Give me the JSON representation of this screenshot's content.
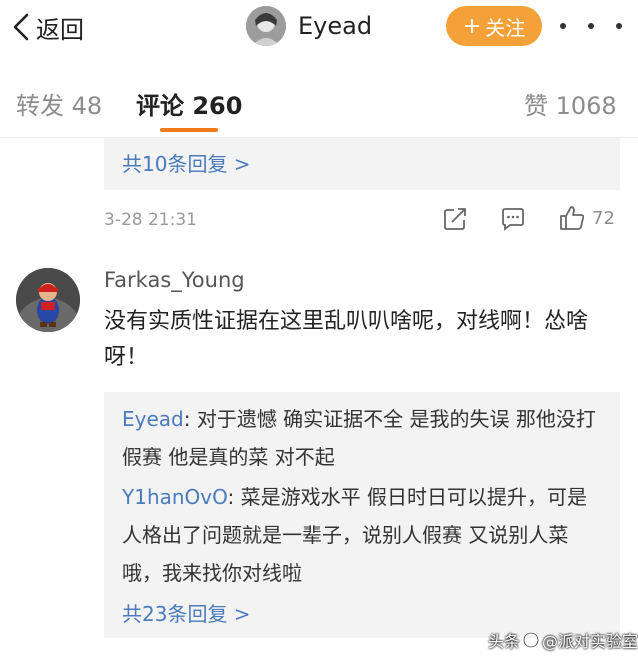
{
  "topbar": {
    "back_label": "返回",
    "profile_name": "Eyead",
    "follow_label": "关注",
    "follow_plus": "+",
    "more_icon": "more-dots-icon",
    "accent_color": "#f5a13a"
  },
  "tabs": {
    "repost": "转发 48",
    "comments": "评论 260",
    "likes": "赞 1068",
    "active_color": "#f27a1a"
  },
  "previous_comment": {
    "more_replies": "共10条回复 >",
    "time": "3-28 21:31",
    "like_count": "72"
  },
  "comment": {
    "user": "Farkas_Young",
    "text": "没有实质性证据在这里乱叭叭啥呢，对线啊！怂啥呀！",
    "replies": [
      {
        "author": "Eyead",
        "text": ": 对于遗憾 确实证据不全 是我的失误 那他没打假赛 他是真的菜 对不起"
      },
      {
        "author": "Y1hanOvO",
        "text": ": 菜是游戏水平 假日时日可以提升，可是人格出了问题就是一辈子，说别人假赛 又说别人菜哦，我来找你对线啦"
      }
    ],
    "more_replies": "共23条回复 >"
  },
  "watermark": {
    "prefix": "头条",
    "text": "@派对实验室"
  }
}
